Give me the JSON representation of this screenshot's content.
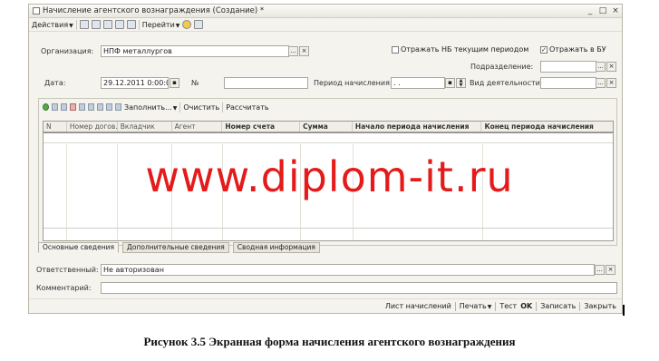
{
  "window": {
    "title": "Начисление агентского вознаграждения (Создание) *",
    "controls": [
      "_",
      "□",
      "×"
    ]
  },
  "toolbar": {
    "actions": "Действия",
    "goto": "Перейти"
  },
  "form": {
    "org_label": "Организация:",
    "org_value": "НПФ металлургов",
    "org_btn_select": "...",
    "org_btn_clear": "×",
    "show_nb_label": "Отражать НБ текущим периодом",
    "show_nb_checked": false,
    "show_bu_label": "Отражать в БУ",
    "show_bu_checked": true,
    "subdivision_label": "Подразделение:",
    "date_label": "Дата:",
    "date_value": "29.12.2011  0:00:00",
    "number_label": "№",
    "period_label": "Период начисления:",
    "period_value": " .  .",
    "activity_label": "Вид деятельности:"
  },
  "table_toolbar": {
    "fill": "Заполнить...",
    "clear": "Очистить",
    "calculate": "Рассчитать"
  },
  "table": {
    "columns": [
      {
        "label": "N",
        "bold": false
      },
      {
        "label": "Номер догов...",
        "bold": false
      },
      {
        "label": "Вкладчик",
        "bold": false
      },
      {
        "label": "Агент",
        "bold": false
      },
      {
        "label": "Номер счета",
        "bold": true
      },
      {
        "label": "Сумма",
        "bold": true
      },
      {
        "label": "Начало периода начисления",
        "bold": true
      },
      {
        "label": "Конец периода начисления",
        "bold": true
      }
    ]
  },
  "tabs": [
    "Основные сведения",
    "Дополнительные сведения",
    "Сводная информация"
  ],
  "responsible": {
    "label": "Ответственный:",
    "value": "Не авторизован"
  },
  "comment": {
    "label": "Комментарий:",
    "value": ""
  },
  "bottom": {
    "sheet": "Лист начислений",
    "print": "Печать",
    "test": "Тест",
    "ok": "OK",
    "save": "Записать",
    "close": "Закрыть"
  },
  "watermark": "www.diplom-it.ru",
  "caption": "Рисунок 3.5 Экранная форма начисления агентского вознаграждения"
}
